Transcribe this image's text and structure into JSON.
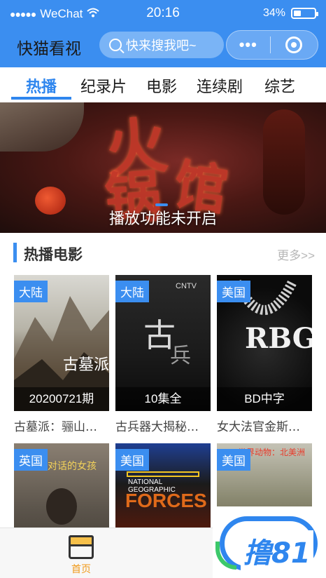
{
  "status_bar": {
    "carrier": "WeChat",
    "time": "20:16",
    "battery_percent": "34%",
    "battery_level": 0.34
  },
  "header": {
    "app_title": "快猫看视",
    "search_placeholder": "快来搜我吧~",
    "more_label": "•••"
  },
  "tabs": [
    {
      "label": "热播",
      "active": true
    },
    {
      "label": "纪录片",
      "active": false
    },
    {
      "label": "电影",
      "active": false
    },
    {
      "label": "连续剧",
      "active": false
    },
    {
      "label": "综艺",
      "active": false
    }
  ],
  "banner": {
    "caption": "播放功能未开启"
  },
  "section": {
    "title": "热播电影",
    "more": "更多>>"
  },
  "cards": [
    {
      "badge": "大陆",
      "overlay": "20200721期",
      "title": "古墓派：骊山…"
    },
    {
      "badge": "大陆",
      "overlay": "10集全",
      "title": "古兵器大揭秘…"
    },
    {
      "badge": "美国",
      "overlay": "BD中字",
      "title": "女大法官金斯…"
    },
    {
      "badge": "英国",
      "overlay": "",
      "title": ""
    },
    {
      "badge": "美国",
      "overlay": "",
      "title": ""
    },
    {
      "badge": "美国",
      "overlay": "",
      "title": ""
    }
  ],
  "poster_art": {
    "p1_title": "古墓派",
    "p2_logo": "CNTV",
    "p3_letters": "RBG",
    "p4_text": "对话的女孩",
    "p5_brand": "NATIONAL GEOGRAPHIC",
    "p5_title": "FORCES",
    "p6_text": "世界动物：北美洲"
  },
  "bottom_nav": {
    "home_label": "首页"
  },
  "watermark": {
    "text": "撸81"
  },
  "colors": {
    "brand_blue": "#3b8ef0",
    "home_active": "#f09a1a"
  }
}
